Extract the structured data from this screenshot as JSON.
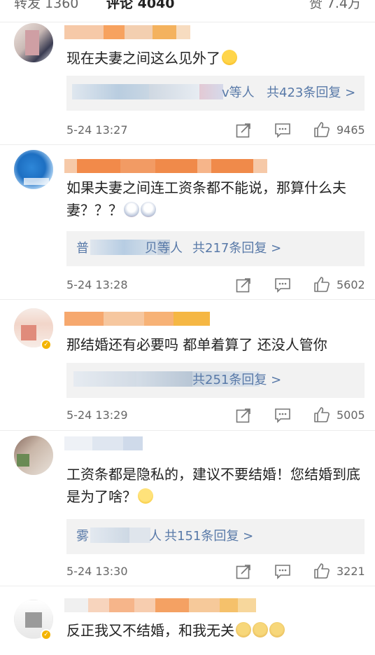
{
  "header": {
    "repost": "转发 1360",
    "comments": "评论 4040",
    "likes": "赞 7.4万"
  },
  "colors": {
    "link": "#5879a8",
    "badge": "#f4b400",
    "meta": "#666666"
  },
  "comments": [
    {
      "text": "现在夫妻之间这么见外了",
      "emoji": [
        "laugh-cry"
      ],
      "reply_suffix": "v等人",
      "reply_count": "共423条回复 >",
      "time": "5-24 13:27",
      "likes": "9465"
    },
    {
      "text": "如果夫妻之间连工资条都不能说，那算什么夫妻？？？",
      "emoji": [
        "shocked",
        "shocked"
      ],
      "reply_prefix": "普",
      "reply_suffix": "贝等人",
      "reply_count": "共217条回复 >",
      "time": "5-24 13:28",
      "likes": "5602"
    },
    {
      "text": "那结婚还有必要吗 都单着算了 还没人管你",
      "emoji": [],
      "reply_count": "共251条回复 >",
      "time": "5-24 13:29",
      "likes": "5005"
    },
    {
      "text": "工资条都是隐私的，建议不要结婚！您结婚到底是为了啥？",
      "emoji": [
        "grin"
      ],
      "reply_prefix": "雾",
      "reply_suffix": "人",
      "reply_count": "共151条回复 >",
      "time": "5-24 13:30",
      "likes": "3221"
    },
    {
      "text": "反正我又不结婚，和我无关",
      "emoji": [
        "doge",
        "doge",
        "doge"
      ],
      "reply_count": "",
      "time": "",
      "likes": ""
    }
  ]
}
